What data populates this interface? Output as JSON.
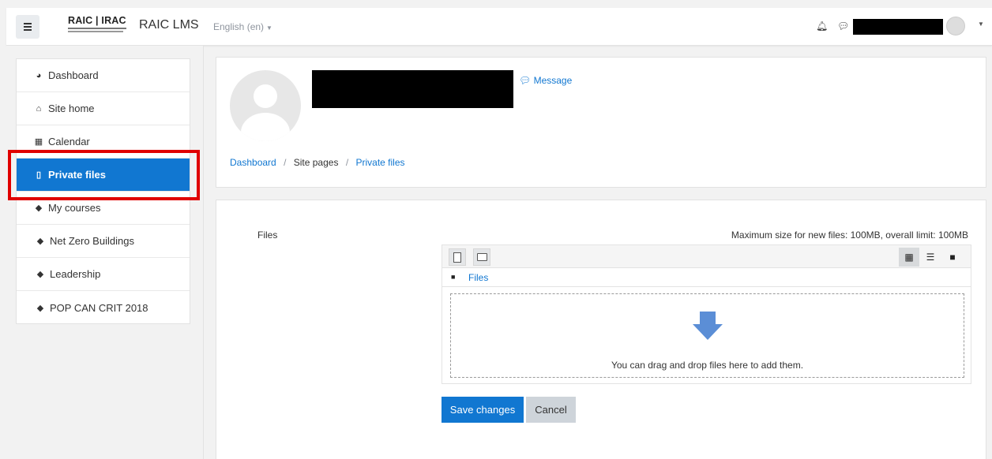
{
  "navbar": {
    "menu_icon": "hamburger-icon",
    "logo_text": "RAIC | IRAC",
    "site_name": "RAIC LMS",
    "language": "English (en)",
    "notification_icon": "bell-icon",
    "messages_icon": "chat-icon"
  },
  "sidebar": {
    "items": [
      {
        "label": "Dashboard",
        "icon": "dashboard-icon"
      },
      {
        "label": "Site home",
        "icon": "home-icon"
      },
      {
        "label": "Calendar",
        "icon": "calendar-icon"
      },
      {
        "label": "Private files",
        "icon": "file-icon",
        "active": true
      },
      {
        "label": "My courses",
        "icon": "graduation-cap-icon"
      },
      {
        "label": "Net Zero Buildings",
        "icon": "graduation-cap-icon"
      },
      {
        "label": "Leadership",
        "icon": "graduation-cap-icon"
      },
      {
        "label": "POP CAN CRIT 2018",
        "icon": "graduation-cap-icon"
      }
    ]
  },
  "header": {
    "message_label": "Message",
    "breadcrumb": [
      "Dashboard",
      "Site pages",
      "Private files"
    ]
  },
  "main": {
    "files_label": "Files",
    "max_size": "Maximum size for new files: 100MB, overall limit: 100MB",
    "path_label": "Files",
    "drop_text": "You can drag and drop files here to add them.",
    "save_label": "Save changes",
    "cancel_label": "Cancel"
  },
  "colors": {
    "primary": "#1177d1",
    "highlight": "#e00000",
    "arrow": "#5b8ed6"
  }
}
